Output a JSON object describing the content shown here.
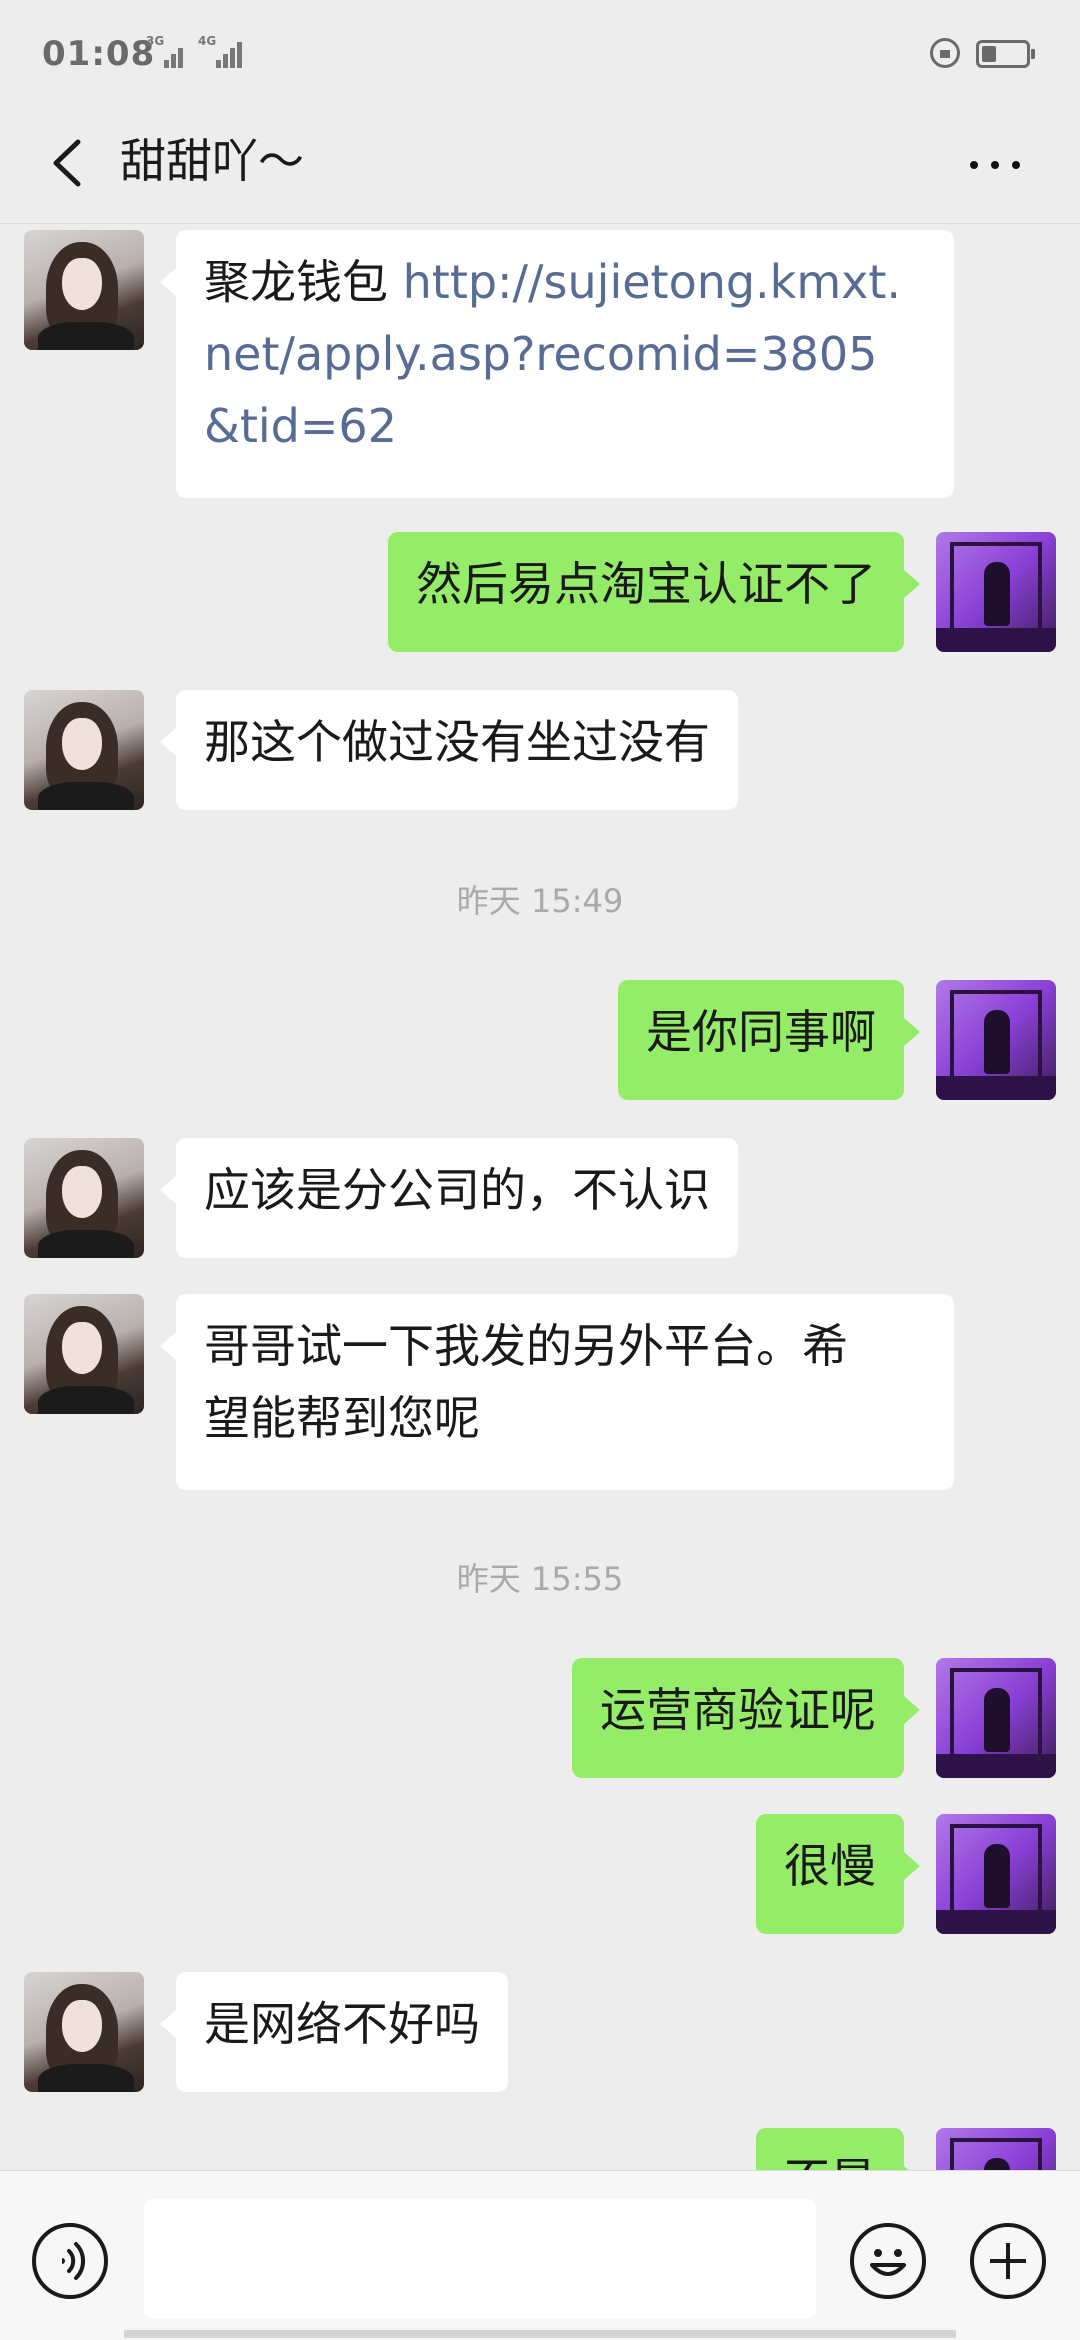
{
  "status_bar": {
    "time": "01:08",
    "network_1": "3G",
    "network_2": "4G"
  },
  "header": {
    "title": "甜甜吖～"
  },
  "messages": [
    {
      "side": "left",
      "text_prefix": "聚龙钱包 ",
      "link_line1": "http://sujietong.kmxt.",
      "link_line2": "net/apply.asp?recomid=3805",
      "link_line3": "&tid=62"
    },
    {
      "side": "right",
      "text": "然后易点淘宝认证不了"
    },
    {
      "side": "left",
      "text": "那这个做过没有坐过没有"
    },
    {
      "timestamp": "昨天 15:49"
    },
    {
      "side": "right",
      "text": "是你同事啊"
    },
    {
      "side": "left",
      "text": "应该是分公司的，不认识"
    },
    {
      "side": "left",
      "line1": "哥哥试一下我发的另外平台。希",
      "line2": "望能帮到您呢"
    },
    {
      "timestamp": "昨天 15:55"
    },
    {
      "side": "right",
      "text": "运营商验证呢"
    },
    {
      "side": "right",
      "text": "很慢"
    },
    {
      "side": "left",
      "text": "是网络不好吗"
    },
    {
      "side": "right",
      "text": "不是"
    }
  ],
  "input_bar": {
    "placeholder": ""
  },
  "icons": {
    "back": "chevron-left-icon",
    "more": "more-dots-icon",
    "voice": "voice-icon",
    "emoji": "emoji-icon",
    "plus": "plus-icon"
  },
  "colors": {
    "sent_bubble": "#95ec69",
    "received_bubble": "#ffffff",
    "background": "#ededed",
    "link": "#576b95"
  }
}
